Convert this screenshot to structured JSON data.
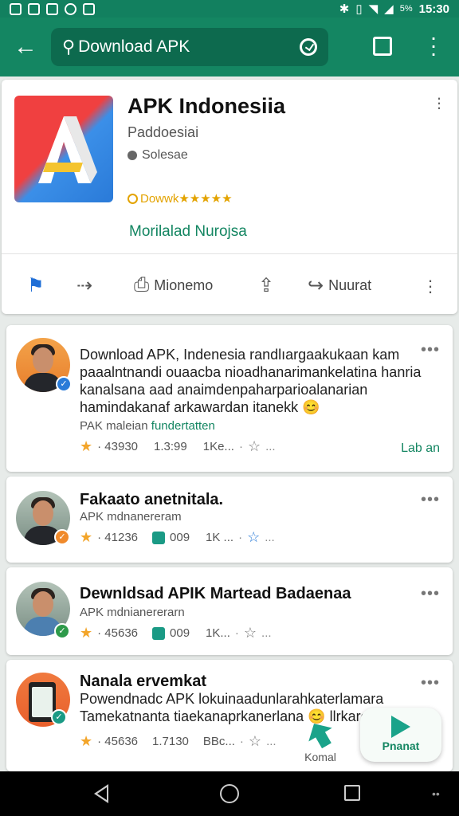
{
  "status_bar": {
    "time": "15:30",
    "battery": "5%"
  },
  "app_bar": {
    "search_text": "Download APK"
  },
  "app": {
    "title": "APK Indonesiia",
    "subtitle": "Paddoesiai",
    "category": "Solesae",
    "rating_text": "Dowwk★★★★★",
    "link": "Morilalad Nurojsa"
  },
  "actions": {
    "bookmark_label": "Mionemo",
    "share_label": "Nuurat"
  },
  "posts": [
    {
      "title": "Download APK",
      "body": "Download APK, Indenesia randlıargaakukaan kam paaalntnandi ouaacba nioadhanarimankelatina hanria kanalsana aad anaimdenpaharparioalanarian hamindakanaf arkawardan itanekk 😊",
      "meta_prefix": "PAK maleian",
      "meta_link": "fundertatten",
      "stat1": "· 43930",
      "stat2": "1.3:99",
      "stat3": "1Ke...",
      "link": "Lab an"
    },
    {
      "title": "Fakaato anetnitala.",
      "meta": "APK mdnanereram",
      "stat1": "· 41236",
      "stat2": "009",
      "stat3": "1K ..."
    },
    {
      "title": "Dewnldsad APIK Martead Badaenaa",
      "meta": "APK mdnianererarn",
      "stat1": "· 45636",
      "stat2": "009",
      "stat3": "1K..."
    },
    {
      "title": "Nanala ervemkat",
      "body": "Powendnadc APK lokuinaadunlarahkaterlamara Tamekatnanta tiaekanaprkanerlana 😊 llrkaromd",
      "stat1": "· 45636",
      "stat2": "1.7130",
      "stat3": "BBc..."
    }
  ],
  "fabs": {
    "komal_label": "Komal",
    "pranat_label": "Pnanat"
  },
  "colors": {
    "primary": "#148662",
    "search_bg": "#0d6a4e",
    "accent_star": "#f3a52a"
  }
}
